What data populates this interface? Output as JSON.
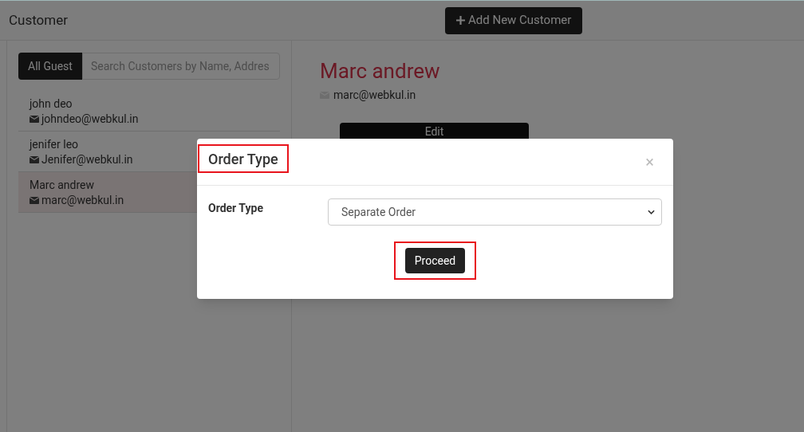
{
  "header": {
    "title": "Customer",
    "add_button": "Add New Customer"
  },
  "filter": {
    "tab": "All Guest",
    "search_placeholder": "Search Customers by Name, Addres"
  },
  "customers": [
    {
      "name": "john deo",
      "email": "johndeo@webkul.in",
      "selected": false
    },
    {
      "name": "jenifer leo",
      "email": "Jenifer@webkul.in",
      "selected": false
    },
    {
      "name": "Marc andrew",
      "email": "marc@webkul.in",
      "selected": true
    }
  ],
  "detail": {
    "name": "Marc andrew",
    "email": "marc@webkul.in",
    "edit_button": "Edit"
  },
  "modal": {
    "title": "Order Type",
    "close": "×",
    "field_label": "Order Type",
    "field_value": "Separate Order",
    "proceed_button": "Proceed"
  }
}
